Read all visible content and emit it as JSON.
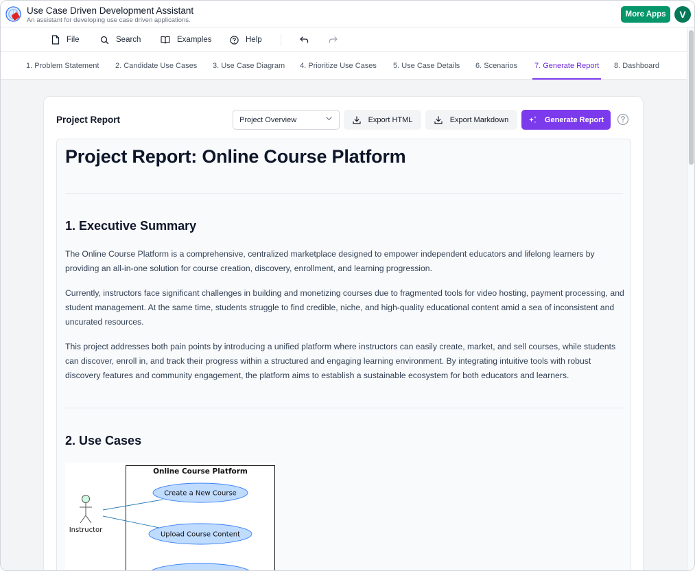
{
  "app": {
    "title": "Use Case Driven Development Assistant",
    "subtitle": "An assistant for developing use case driven applications.",
    "more_apps": "More Apps",
    "avatar_initial": "V"
  },
  "menu": {
    "file": "File",
    "search": "Search",
    "examples": "Examples",
    "help": "Help"
  },
  "steps": [
    "1. Problem Statement",
    "2. Candidate Use Cases",
    "3. Use Case Diagram",
    "4. Prioritize Use Cases",
    "5. Use Case Details",
    "6. Scenarios",
    "7. Generate Report",
    "8. Dashboard"
  ],
  "active_step": "7. Generate Report",
  "card": {
    "title": "Project Report",
    "select_value": "Project Overview",
    "export_html": "Export HTML",
    "export_markdown": "Export Markdown",
    "generate_report": "Generate Report"
  },
  "report": {
    "title": "Project Report: Online Course Platform",
    "section1_heading": "1. Executive Summary",
    "paragraphs": [
      "The Online Course Platform is a comprehensive, centralized marketplace designed to empower independent educators and lifelong learners by providing an all-in-one solution for course creation, discovery, enrollment, and learning progression.",
      "Currently, instructors face significant challenges in building and monetizing courses due to fragmented tools for video hosting, payment processing, and student management. At the same time, students struggle to find credible, niche, and high-quality educational content amid a sea of inconsistent and uncurated resources.",
      "This project addresses both pain points by introducing a unified platform where instructors can easily create, market, and sell courses, while students can discover, enroll in, and track their progress within a structured and engaging learning environment. By integrating intuitive tools with robust discovery features and community engagement, the platform aims to establish a sustainable ecosystem for both educators and learners."
    ],
    "section2_heading": "2. Use Cases",
    "diagram": {
      "system_name": "Online Course Platform",
      "actor": "Instructor",
      "use_cases": [
        "Create a New Course",
        "Upload Course Content"
      ]
    }
  },
  "colors": {
    "accent": "#7c3aed",
    "more_apps_bg": "#059669",
    "use_case_fill": "#bfdbfe"
  }
}
